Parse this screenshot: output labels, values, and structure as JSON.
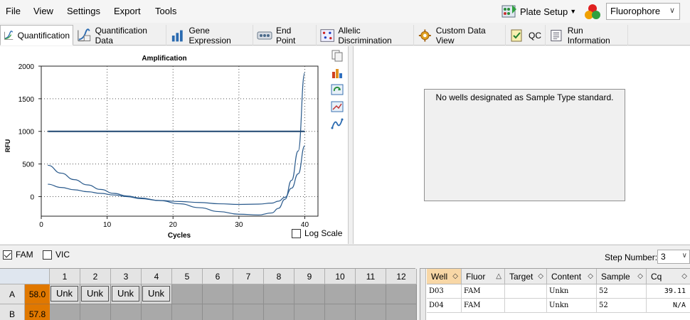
{
  "menu": {
    "file": "File",
    "view": "View",
    "settings": "Settings",
    "export": "Export",
    "tools": "Tools"
  },
  "toolbar": {
    "plate_setup": "Plate Setup",
    "fluorophore": "Fluorophore"
  },
  "tabs": [
    {
      "label": "Quantification",
      "icon": "amplification-chart-icon"
    },
    {
      "label": "Quantification Data",
      "icon": "quantification-data-icon"
    },
    {
      "label": "Gene Expression",
      "icon": "bar-chart-icon"
    },
    {
      "label": "End Point",
      "icon": "end-point-icon"
    },
    {
      "label": "Allelic Discrimination",
      "icon": "allelic-discrimination-icon"
    },
    {
      "label": "Custom Data View",
      "icon": "gear-icon"
    },
    {
      "label": "QC",
      "icon": "qc-icon"
    },
    {
      "label": "Run Information",
      "icon": "run-information-icon"
    }
  ],
  "chart_data": {
    "type": "line",
    "title": "Amplification",
    "xlabel": "Cycles",
    "ylabel": "RFU",
    "xlim": [
      0,
      42
    ],
    "ylim": [
      -300,
      2000
    ],
    "xticks": [
      "0",
      "10",
      "20",
      "30",
      "40"
    ],
    "yticks": [
      "0",
      "500",
      "1000",
      "1500",
      "2000"
    ],
    "grid": true,
    "threshold": 1000,
    "series": [
      {
        "x": [
          1,
          3,
          5,
          7,
          9,
          11,
          13,
          15,
          18,
          21,
          24,
          27,
          30,
          33,
          35,
          36,
          37,
          38,
          39,
          40
        ],
        "values": [
          480,
          360,
          260,
          180,
          110,
          50,
          10,
          -20,
          -60,
          -110,
          -170,
          -230,
          -270,
          -280,
          -250,
          -180,
          -40,
          250,
          700,
          1900
        ]
      },
      {
        "x": [
          1,
          3,
          5,
          7,
          9,
          11,
          13,
          15,
          18,
          21,
          24,
          27,
          30,
          33,
          35,
          36,
          37,
          38,
          39,
          40
        ],
        "values": [
          190,
          140,
          105,
          75,
          50,
          25,
          0,
          -30,
          -60,
          -75,
          -90,
          -110,
          -120,
          -115,
          -100,
          -70,
          -10,
          130,
          350,
          780
        ]
      }
    ],
    "colors": {
      "curve": "#2a5a8c",
      "threshold": "#1e4670"
    }
  },
  "chart_options": {
    "log_scale_label": "Log Scale",
    "log_scale_checked": false
  },
  "right_panel": {
    "std_message": "No wells designated as Sample Type standard."
  },
  "fluor_filters": {
    "fam": "FAM",
    "vic": "VIC",
    "fam_checked": true,
    "vic_checked": false
  },
  "step": {
    "label": "Step Number:",
    "value": "3"
  },
  "plate": {
    "columns": [
      "1",
      "2",
      "3",
      "4",
      "5",
      "6",
      "7",
      "8",
      "9",
      "10",
      "11",
      "12"
    ],
    "rows": [
      {
        "label": "A",
        "temp": "58.0",
        "wells": [
          "Unk",
          "Unk",
          "Unk",
          "Unk",
          "",
          "",
          "",
          "",
          "",
          "",
          "",
          ""
        ]
      },
      {
        "label": "B",
        "temp": "57.8",
        "wells": [
          "",
          "",
          "",
          "",
          "",
          "",
          "",
          "",
          "",
          "",
          "",
          ""
        ]
      }
    ]
  },
  "well_table": {
    "headers": [
      "Well",
      "Fluor",
      "Target",
      "Content",
      "Sample",
      "Cq"
    ],
    "rows": [
      [
        "D03",
        "FAM",
        "",
        "Unkn",
        "52",
        "39.11"
      ],
      [
        "D04",
        "FAM",
        "",
        "Unkn",
        "52",
        "N/A"
      ]
    ]
  }
}
